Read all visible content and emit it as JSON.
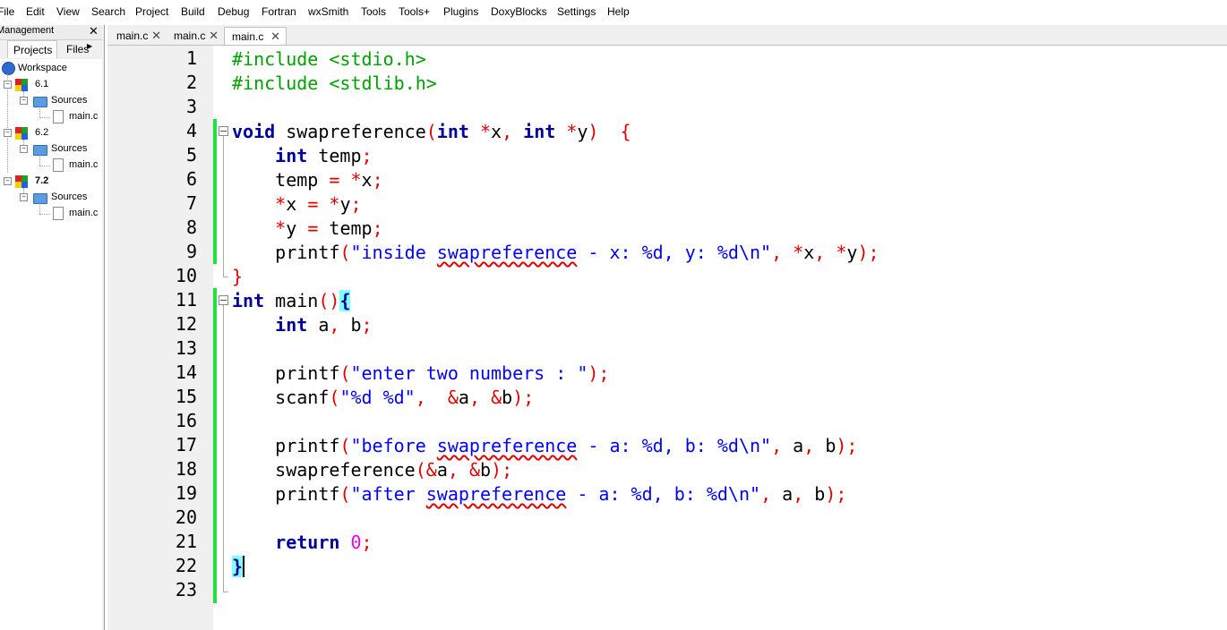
{
  "menu": [
    "File",
    "Edit",
    "View",
    "Search",
    "Project",
    "Build",
    "Debug",
    "Fortran",
    "wxSmith",
    "Tools",
    "Tools+",
    "Plugins",
    "DoxyBlocks",
    "Settings",
    "Help"
  ],
  "management": {
    "title": "Management",
    "close": "✕",
    "tabs": {
      "projects": "Projects",
      "files": "Files"
    },
    "tree": {
      "workspace": "Workspace",
      "projects": [
        {
          "name": "6.1",
          "folder": "Sources",
          "file": "main.c"
        },
        {
          "name": "6.2",
          "folder": "Sources",
          "file": "main.c"
        },
        {
          "name": "7.2",
          "folder": "Sources",
          "file": "main.c"
        }
      ]
    }
  },
  "editor_tabs": [
    {
      "label": "main.c",
      "close": "✕"
    },
    {
      "label": "main.c",
      "close": "✕"
    },
    {
      "label": "main.c",
      "close": "✕"
    }
  ],
  "line_numbers": [
    "1",
    "2",
    "3",
    "4",
    "5",
    "6",
    "7",
    "8",
    "9",
    "10",
    "11",
    "12",
    "13",
    "14",
    "15",
    "16",
    "17",
    "18",
    "19",
    "20",
    "21",
    "22",
    "23"
  ],
  "code": {
    "l1": {
      "directive": "#include",
      "header": " <stdio.h>"
    },
    "l2": {
      "directive": "#include",
      "header": " <stdlib.h>"
    },
    "l4": {
      "void": "void",
      "name": " swapreference",
      "lp": "(",
      "int1": "int",
      "star1": " *",
      "x": "x",
      "comma": ",",
      "sp": " ",
      "int2": "int",
      "star2": " *",
      "y": "y",
      "rp": ")",
      "lb": "  {"
    },
    "l5": {
      "indent": "    ",
      "int": "int",
      "rest": " temp",
      "semi": ";"
    },
    "l6": {
      "indent": "    ",
      "a": "temp ",
      "eq": "=",
      "sp": " ",
      "star": "*",
      "x": "x",
      "semi": ";"
    },
    "l7": {
      "indent": "    ",
      "star1": "*",
      "x": "x ",
      "eq": "=",
      "sp": " ",
      "star2": "*",
      "y": "y",
      "semi": ";"
    },
    "l8": {
      "indent": "    ",
      "star1": "*",
      "y": "y ",
      "eq": "=",
      "sp": " temp",
      "semi": ";"
    },
    "l9": {
      "indent": "    ",
      "fn": "printf",
      "lp": "(",
      "s1": "\"inside ",
      "s2": "swapreference",
      "s3": " - x: %d, y: %d\\n\"",
      "comma1": ",",
      "sp1": " ",
      "star1": "*",
      "x": "x",
      "comma2": ",",
      "sp2": " ",
      "star2": "*",
      "y": "y",
      "rp": ")",
      "semi": ";"
    },
    "l10": {
      "rb": "}"
    },
    "l11": {
      "int": "int",
      "name": " main",
      "paren": "()",
      "lb": "{"
    },
    "l12": {
      "indent": "    ",
      "int": "int",
      "a": " a",
      "comma": ",",
      "b": " b",
      "semi": ";"
    },
    "l14": {
      "indent": "    ",
      "fn": "printf",
      "lp": "(",
      "s": "\"enter two numbers : \"",
      "rp": ")",
      "semi": ";"
    },
    "l15": {
      "indent": "    ",
      "fn": "scanf",
      "lp": "(",
      "s": "\"%d %d\"",
      "comma1": ",",
      "sp1": "  ",
      "amp1": "&",
      "a": "a",
      "comma2": ",",
      "sp2": " ",
      "amp2": "&",
      "b": "b",
      "rp": ")",
      "semi": ";"
    },
    "l17": {
      "indent": "    ",
      "fn": "printf",
      "lp": "(",
      "s1": "\"before ",
      "s2": "swapreference",
      "s3": " - a: %d, b: %d\\n\"",
      "comma1": ",",
      "a": " a",
      "comma2": ",",
      "b": " b",
      "rp": ")",
      "semi": ";"
    },
    "l18": {
      "indent": "    ",
      "fn": "swapreference",
      "lp": "(",
      "amp1": "&",
      "a": "a",
      "comma": ",",
      "sp": " ",
      "amp2": "&",
      "b": "b",
      "rp": ")",
      "semi": ";"
    },
    "l19": {
      "indent": "    ",
      "fn": "printf",
      "lp": "(",
      "s1": "\"after ",
      "s2": "swapreference",
      "s3": " - a: %d, b: %d\\n\"",
      "comma1": ",",
      "a": " a",
      "comma2": ",",
      "b": " b",
      "rp": ")",
      "semi": ";"
    },
    "l21": {
      "indent": "    ",
      "ret": "return",
      "sp": " ",
      "zero": "0",
      "semi": ";"
    },
    "l22": {
      "rb": "}"
    }
  }
}
